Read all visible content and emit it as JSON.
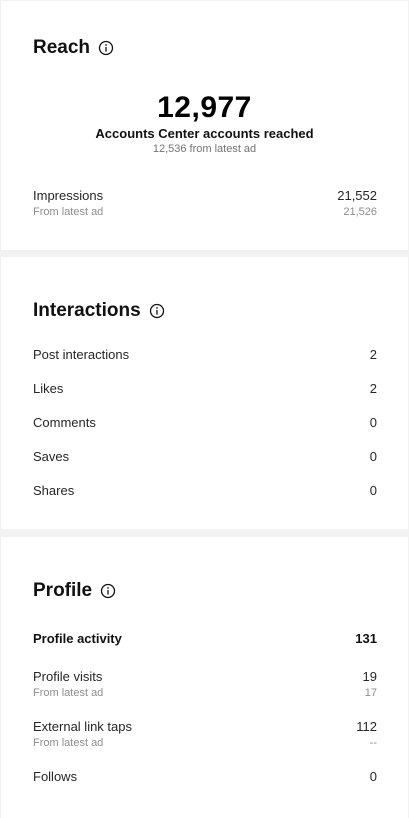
{
  "reach": {
    "title": "Reach",
    "big_number": "12,977",
    "big_label": "Accounts Center accounts reached",
    "big_sub": "12,536 from latest ad",
    "impressions": {
      "label": "Impressions",
      "value": "21,552",
      "sub_label": "From latest ad",
      "sub_value": "21,526"
    }
  },
  "interactions": {
    "title": "Interactions",
    "rows": [
      {
        "label": "Post interactions",
        "value": "2"
      },
      {
        "label": "Likes",
        "value": "2"
      },
      {
        "label": "Comments",
        "value": "0"
      },
      {
        "label": "Saves",
        "value": "0"
      },
      {
        "label": "Shares",
        "value": "0"
      }
    ]
  },
  "profile": {
    "title": "Profile",
    "activity": {
      "label": "Profile activity",
      "value": "131"
    },
    "visits": {
      "label": "Profile visits",
      "value": "19",
      "sub_label": "From latest ad",
      "sub_value": "17"
    },
    "link_taps": {
      "label": "External link taps",
      "value": "112",
      "sub_label": "From latest ad",
      "sub_value": "--"
    },
    "follows": {
      "label": "Follows",
      "value": "0"
    }
  },
  "icons": {
    "info": "info-icon"
  }
}
